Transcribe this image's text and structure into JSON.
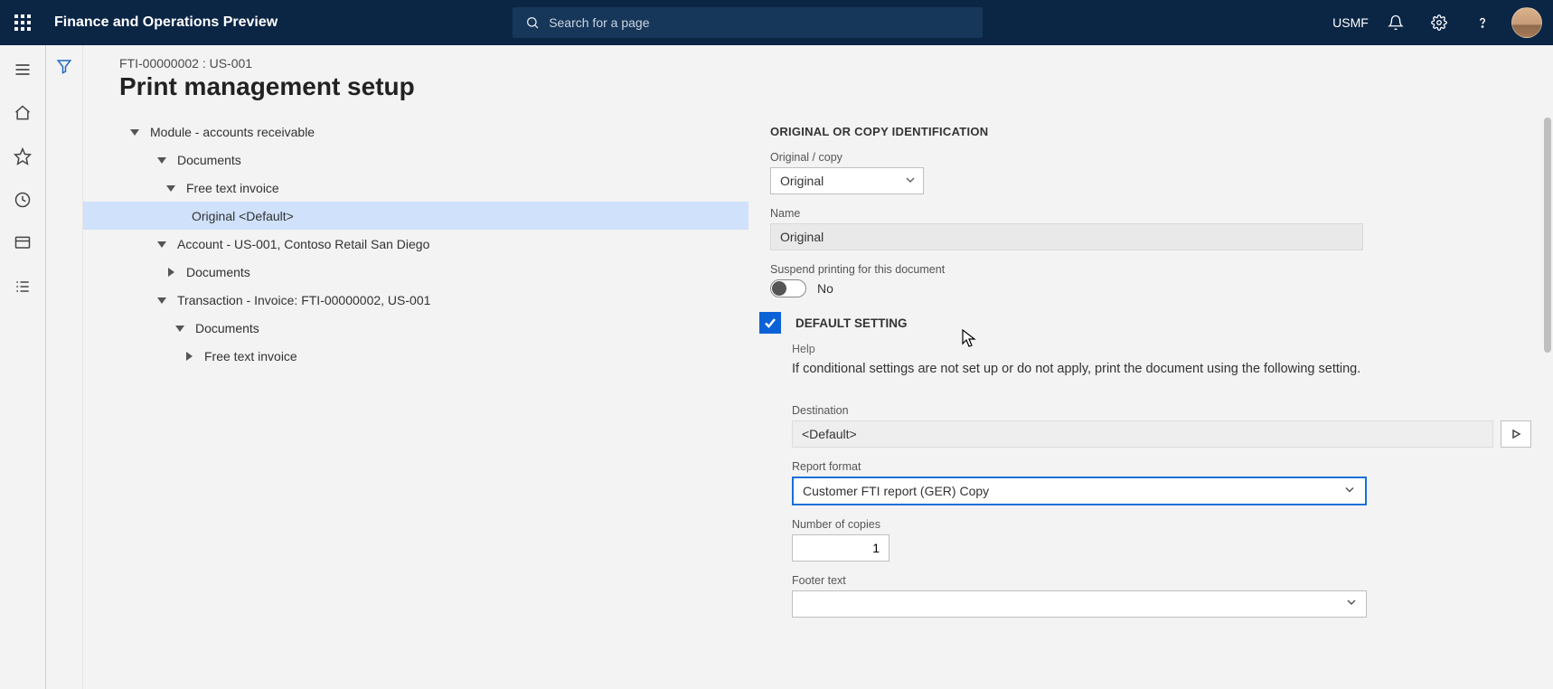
{
  "header": {
    "app_title": "Finance and Operations Preview",
    "search_placeholder": "Search for a page",
    "company": "USMF"
  },
  "page": {
    "breadcrumb": "FTI-00000002 : US-001",
    "title": "Print management setup"
  },
  "tree": {
    "n0": "Module - accounts receivable",
    "n1": "Documents",
    "n2": "Free text invoice",
    "n3": "Original <Default>",
    "n4": "Account - US-001, Contoso Retail San Diego",
    "n5": "Documents",
    "n6": "Transaction - Invoice: FTI-00000002, US-001",
    "n7": "Documents",
    "n8": "Free text invoice"
  },
  "form": {
    "section1_title": "ORIGINAL OR COPY IDENTIFICATION",
    "original_copy_label": "Original / copy",
    "original_copy_value": "Original",
    "name_label": "Name",
    "name_value": "Original",
    "suspend_label": "Suspend printing for this document",
    "suspend_value": "No",
    "default_setting_title": "DEFAULT SETTING",
    "help_label": "Help",
    "help_text": "If conditional settings are not set up or do not apply, print the document using the following setting.",
    "destination_label": "Destination",
    "destination_value": "<Default>",
    "report_format_label": "Report format",
    "report_format_value": "Customer FTI report (GER) Copy",
    "copies_label": "Number of copies",
    "copies_value": "1",
    "footer_label": "Footer text"
  }
}
